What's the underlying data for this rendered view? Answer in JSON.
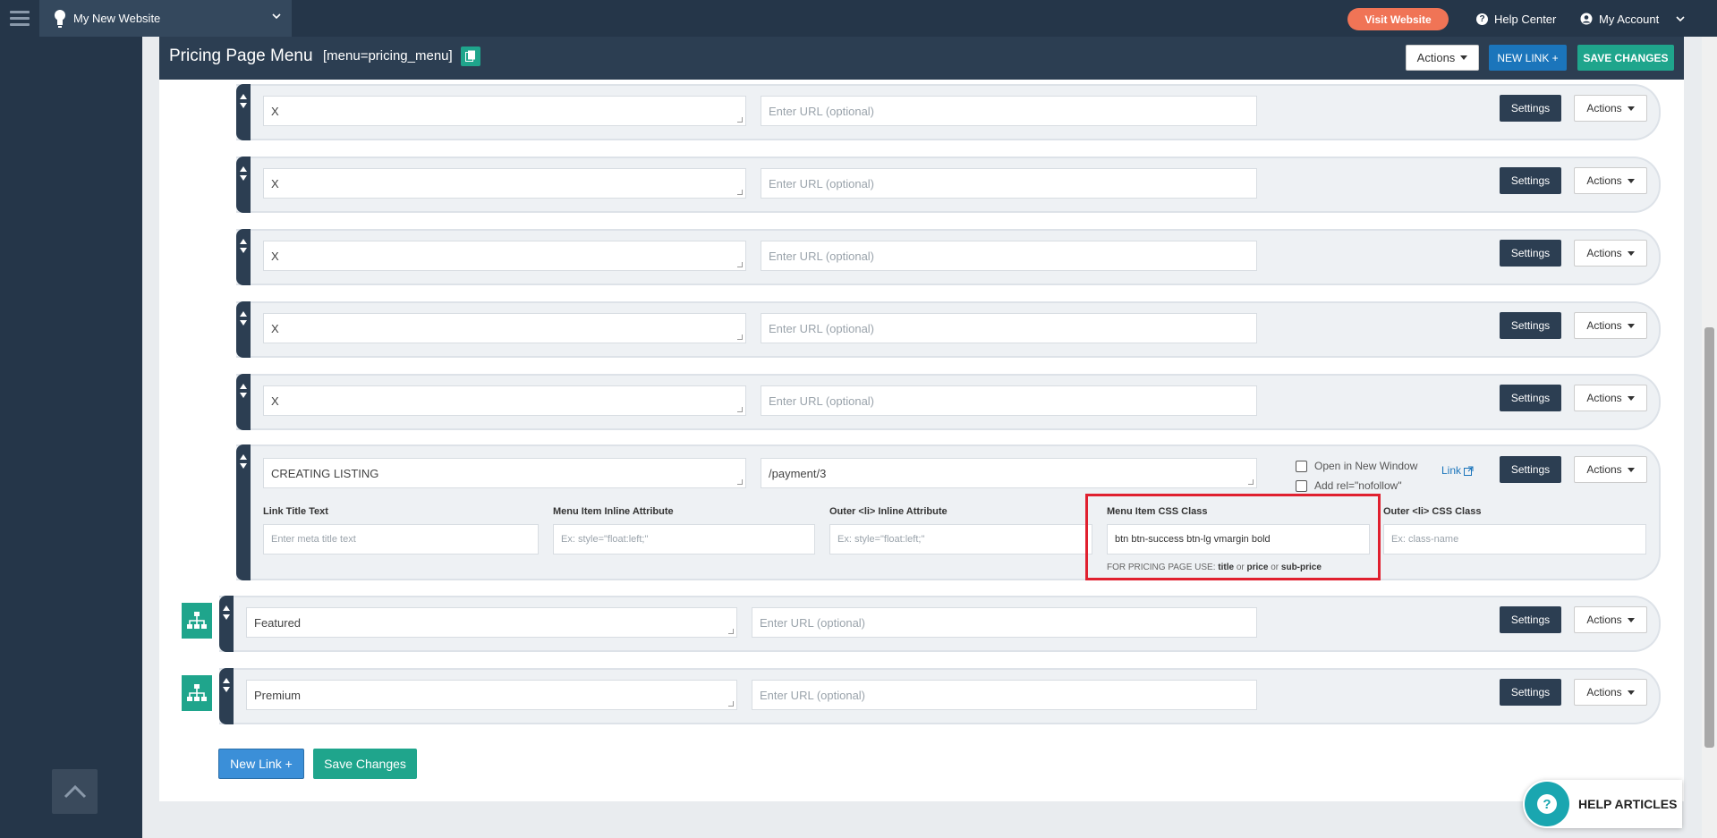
{
  "topbar": {
    "site_name": "My New Website",
    "visit_website": "Visit Website",
    "help_center": "Help Center",
    "my_account": "My Account"
  },
  "header": {
    "title": "Pricing Page Menu",
    "shortcode": "[menu=pricing_menu]",
    "actions": "Actions",
    "new_link": "NEW LINK +",
    "save_changes": "SAVE CHANGES"
  },
  "url_placeholder": "Enter URL (optional)",
  "settings_label": "Settings",
  "actions_label": "Actions",
  "rows": [
    {
      "title": "X"
    },
    {
      "title": "X"
    },
    {
      "title": "X"
    },
    {
      "title": "X"
    },
    {
      "title": "X"
    }
  ],
  "expanded": {
    "title": "CREATING LISTING",
    "url": "/payment/3",
    "open_new_window": "Open in New Window",
    "nofollow": "Add rel=\"nofollow\"",
    "link": "Link",
    "fields": {
      "link_title_label": "Link Title Text",
      "link_title_placeholder": "Enter meta title text",
      "inline_attr_label": "Menu Item Inline Attribute",
      "inline_attr_placeholder": "Ex: style=\"float:left;\"",
      "outer_inline_label": "Outer <li> Inline Attribute",
      "outer_inline_placeholder": "Ex: style=\"float:left;\"",
      "css_class_label": "Menu Item CSS Class",
      "css_class_value": "btn btn-success btn-lg vmargin bold",
      "outer_css_label": "Outer <li> CSS Class",
      "outer_css_placeholder": "Ex: class-name"
    },
    "hint_prefix": "FOR PRICING PAGE USE:",
    "hint_title": "title",
    "hint_or1": "or",
    "hint_price": "price",
    "hint_or2": "or",
    "hint_subprice": "sub-price"
  },
  "parents": [
    {
      "title": "Featured"
    },
    {
      "title": "Premium"
    }
  ],
  "bottom": {
    "new_link": "New Link +",
    "save_changes": "Save Changes"
  },
  "help_articles": "HELP ARTICLES"
}
